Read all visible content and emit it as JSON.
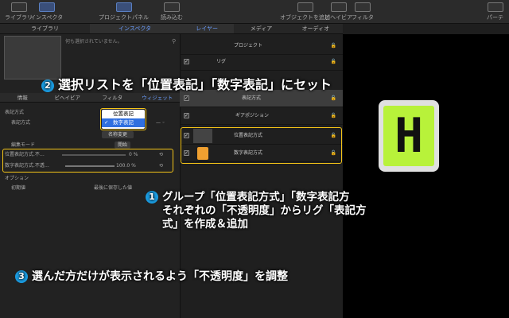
{
  "toolbar": {
    "library": "ライブラリ",
    "inspector": "インスペクタ",
    "project_panel": "プロジェクトパネル",
    "import": "読み込む",
    "add_object": "オブジェクトを追加",
    "preview": "ビヘイビア",
    "filter": "フィルタ",
    "last": "パーテ"
  },
  "left_tabs": [
    "ライブラリ",
    "インスペクタ"
  ],
  "layer_tabs": [
    "レイヤー",
    "メディア",
    "オーディオ"
  ],
  "no_selection": "何も選択されていません。",
  "sub_tabs": [
    "情報",
    "ビヘイビア",
    "フィルタ",
    "ウィジェット"
  ],
  "inspector": {
    "section": "表記方式",
    "row1_label": "表記方式",
    "dropdown_options": [
      "位置表記",
      "数字表記"
    ],
    "rename_button": "名称変更",
    "edit_mode": "編集モード",
    "start_button": "開始",
    "row_pos_label": "位置表記方式.不…",
    "row_pos_value": "0 %",
    "row_num_label": "数字表記方式.不透…",
    "row_num_value": "100.0 %",
    "options": "オプション",
    "initial": "初期値",
    "initial_value": "最後に保存した値"
  },
  "layers": {
    "project": "プロジェクト",
    "rig": "リグ",
    "notation": "表記方式",
    "gear": "ギアポジション",
    "pos_group": "位置表記方式",
    "num_group": "数字表記方式"
  },
  "notes": {
    "n1_num": "1",
    "n1_line1": "グループ「位置表記方式」「数字表記方",
    "n1_line2": "それぞれの「不透明度」からリグ「表記方",
    "n1_line3": "式」を作成＆追加",
    "n2_num": "2",
    "n2_text": "選択リストを「位置表記」「数字表記」にセット",
    "n3_num": "3",
    "n3_text": "選んだ方だけが表示されるよう「不透明度」を調整"
  },
  "lcd_text": "H",
  "colors": {
    "accent": "#6b9eff",
    "highlight": "#f5c518",
    "badge": "#1a9be0",
    "lcd": "#b8f23a"
  }
}
